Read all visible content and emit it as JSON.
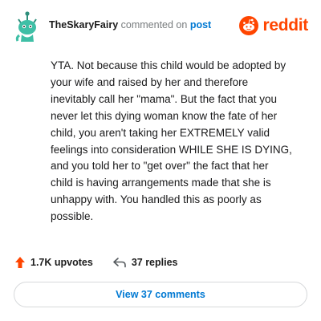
{
  "header": {
    "username": "TheSkaryFairy",
    "action_text": "commented on",
    "link_text": "post",
    "brand": "reddit",
    "avatar_icon": "snoo-avatar-icon",
    "brand_icon": "reddit-logo-icon"
  },
  "comment": {
    "text": "YTA. Not because this child would be adopted by\nyour wife and raised by her and therefore\ninevitably call her \"mama\". But the fact that you\nnever let this dying woman know the fate of her\nchild, you aren't taking her EXTREMELY valid\nfeelings into consideration WHILE SHE IS DYING,\nand you told her to \"get over\" the fact that her\nchild is having arrangements made that she is\nunhappy with. You handled this as poorly as\npossible."
  },
  "actions": {
    "upvotes": "1.7K upvotes",
    "replies": "37 replies",
    "upvote_icon": "upvote-arrow-icon",
    "reply_icon": "reply-icon"
  },
  "footer": {
    "button_label": "View 37 comments"
  },
  "colors": {
    "accent": "#0079d3",
    "brand": "#ff4500",
    "avatar": "#3fbfa6"
  }
}
